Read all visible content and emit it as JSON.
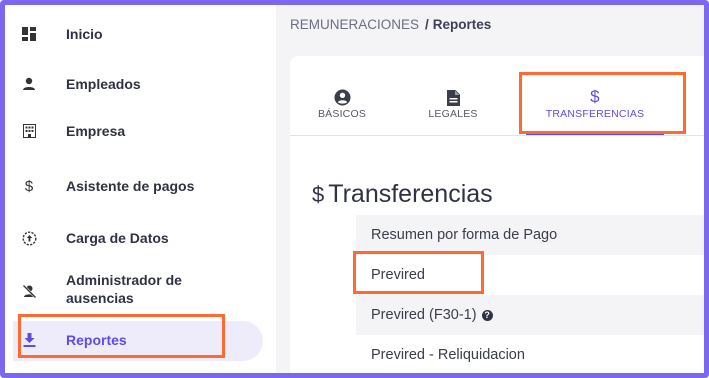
{
  "sidebar": {
    "items": [
      {
        "label": "Inicio",
        "icon": "dashboard-icon"
      },
      {
        "label": "Empleados",
        "icon": "person-icon"
      },
      {
        "label": "Empresa",
        "icon": "building-icon"
      },
      {
        "label": "Asistente de pagos",
        "icon": "dollar-icon"
      },
      {
        "label": "Carga de Datos",
        "icon": "upload-circle-icon"
      },
      {
        "label": "Administrador de ausencias",
        "icon": "person-off-icon"
      },
      {
        "label": "Reportes",
        "icon": "download-icon",
        "active": true
      }
    ]
  },
  "breadcrumb": {
    "parent": "REMUNERACIONES",
    "separator": "/",
    "current": "Reportes"
  },
  "tabs": [
    {
      "label": "BÁSICOS",
      "icon": "account-circle-icon"
    },
    {
      "label": "LEGALES",
      "icon": "document-icon"
    },
    {
      "label": "TRANSFERENCIAS",
      "icon": "dollar-icon",
      "active": true
    }
  ],
  "section": {
    "icon_glyph": "$",
    "title": "Transferencias"
  },
  "reports": [
    {
      "label": "Resumen por forma de Pago"
    },
    {
      "label": "Previred"
    },
    {
      "label": "Previred (F30-1)",
      "help": "?"
    },
    {
      "label": "Previred - Reliquidacion"
    }
  ],
  "colors": {
    "accent": "#5e4ce6",
    "highlight": "#ff6a33",
    "frame": "#7b68ee"
  }
}
